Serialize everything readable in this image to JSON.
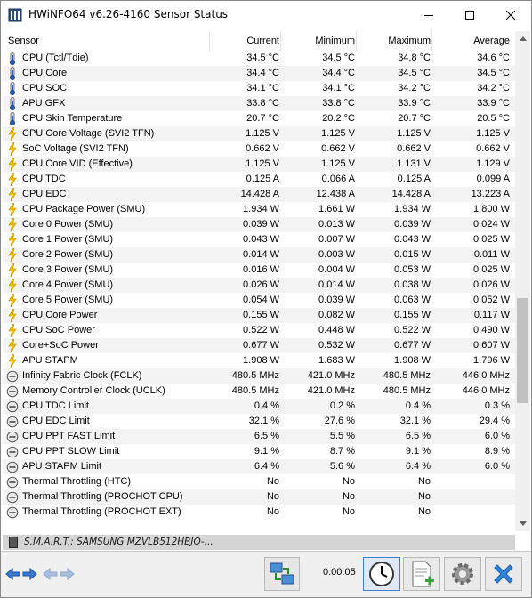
{
  "window": {
    "title": "HWiNFO64 v6.26-4160 Sensor Status"
  },
  "columns": {
    "sensor": "Sensor",
    "current": "Current",
    "minimum": "Minimum",
    "maximum": "Maximum",
    "average": "Average"
  },
  "rows": [
    {
      "icon": "thermometer",
      "name": "CPU (Tctl/Tdie)",
      "cur": "34.5 °C",
      "min": "34.5 °C",
      "max": "34.8 °C",
      "avg": "34.6 °C"
    },
    {
      "icon": "thermometer",
      "name": "CPU Core",
      "cur": "34.4 °C",
      "min": "34.4 °C",
      "max": "34.5 °C",
      "avg": "34.5 °C"
    },
    {
      "icon": "thermometer",
      "name": "CPU SOC",
      "cur": "34.1 °C",
      "min": "34.1 °C",
      "max": "34.2 °C",
      "avg": "34.2 °C"
    },
    {
      "icon": "thermometer",
      "name": "APU GFX",
      "cur": "33.8 °C",
      "min": "33.8 °C",
      "max": "33.9 °C",
      "avg": "33.9 °C"
    },
    {
      "icon": "thermometer",
      "name": "CPU Skin Temperature",
      "cur": "20.7 °C",
      "min": "20.2 °C",
      "max": "20.7 °C",
      "avg": "20.5 °C"
    },
    {
      "icon": "bolt",
      "name": "CPU Core Voltage (SVI2 TFN)",
      "cur": "1.125 V",
      "min": "1.125 V",
      "max": "1.125 V",
      "avg": "1.125 V"
    },
    {
      "icon": "bolt",
      "name": "SoC Voltage (SVI2 TFN)",
      "cur": "0.662 V",
      "min": "0.662 V",
      "max": "0.662 V",
      "avg": "0.662 V"
    },
    {
      "icon": "bolt",
      "name": "CPU Core VID (Effective)",
      "cur": "1.125 V",
      "min": "1.125 V",
      "max": "1.131 V",
      "avg": "1.129 V"
    },
    {
      "icon": "bolt",
      "name": "CPU TDC",
      "cur": "0.125 A",
      "min": "0.066 A",
      "max": "0.125 A",
      "avg": "0.099 A"
    },
    {
      "icon": "bolt",
      "name": "CPU EDC",
      "cur": "14.428 A",
      "min": "12.438 A",
      "max": "14.428 A",
      "avg": "13.223 A"
    },
    {
      "icon": "bolt",
      "name": "CPU Package Power (SMU)",
      "cur": "1.934 W",
      "min": "1.661 W",
      "max": "1.934 W",
      "avg": "1.800 W"
    },
    {
      "icon": "bolt",
      "name": "Core 0 Power (SMU)",
      "cur": "0.039 W",
      "min": "0.013 W",
      "max": "0.039 W",
      "avg": "0.024 W"
    },
    {
      "icon": "bolt",
      "name": "Core 1 Power (SMU)",
      "cur": "0.043 W",
      "min": "0.007 W",
      "max": "0.043 W",
      "avg": "0.025 W"
    },
    {
      "icon": "bolt",
      "name": "Core 2 Power (SMU)",
      "cur": "0.014 W",
      "min": "0.003 W",
      "max": "0.015 W",
      "avg": "0.011 W"
    },
    {
      "icon": "bolt",
      "name": "Core 3 Power (SMU)",
      "cur": "0.016 W",
      "min": "0.004 W",
      "max": "0.053 W",
      "avg": "0.025 W"
    },
    {
      "icon": "bolt",
      "name": "Core 4 Power (SMU)",
      "cur": "0.026 W",
      "min": "0.014 W",
      "max": "0.038 W",
      "avg": "0.026 W"
    },
    {
      "icon": "bolt",
      "name": "Core 5 Power (SMU)",
      "cur": "0.054 W",
      "min": "0.039 W",
      "max": "0.063 W",
      "avg": "0.052 W"
    },
    {
      "icon": "bolt",
      "name": "CPU Core Power",
      "cur": "0.155 W",
      "min": "0.082 W",
      "max": "0.155 W",
      "avg": "0.117 W"
    },
    {
      "icon": "bolt",
      "name": "CPU SoC Power",
      "cur": "0.522 W",
      "min": "0.448 W",
      "max": "0.522 W",
      "avg": "0.490 W"
    },
    {
      "icon": "bolt",
      "name": "Core+SoC Power",
      "cur": "0.677 W",
      "min": "0.532 W",
      "max": "0.677 W",
      "avg": "0.607 W"
    },
    {
      "icon": "bolt",
      "name": "APU STAPM",
      "cur": "1.908 W",
      "min": "1.683 W",
      "max": "1.908 W",
      "avg": "1.796 W"
    },
    {
      "icon": "gauge",
      "name": "Infinity Fabric Clock (FCLK)",
      "cur": "480.5 MHz",
      "min": "421.0 MHz",
      "max": "480.5 MHz",
      "avg": "446.0 MHz"
    },
    {
      "icon": "gauge",
      "name": "Memory Controller Clock (UCLK)",
      "cur": "480.5 MHz",
      "min": "421.0 MHz",
      "max": "480.5 MHz",
      "avg": "446.0 MHz"
    },
    {
      "icon": "gauge",
      "name": "CPU TDC Limit",
      "cur": "0.4 %",
      "min": "0.2 %",
      "max": "0.4 %",
      "avg": "0.3 %"
    },
    {
      "icon": "gauge",
      "name": "CPU EDC Limit",
      "cur": "32.1 %",
      "min": "27.6 %",
      "max": "32.1 %",
      "avg": "29.4 %"
    },
    {
      "icon": "gauge",
      "name": "CPU PPT FAST Limit",
      "cur": "6.5 %",
      "min": "5.5 %",
      "max": "6.5 %",
      "avg": "6.0 %"
    },
    {
      "icon": "gauge",
      "name": "CPU PPT SLOW Limit",
      "cur": "9.1 %",
      "min": "8.7 %",
      "max": "9.1 %",
      "avg": "8.9 %"
    },
    {
      "icon": "gauge",
      "name": "APU STAPM Limit",
      "cur": "6.4 %",
      "min": "5.6 %",
      "max": "6.4 %",
      "avg": "6.0 %"
    },
    {
      "icon": "gauge",
      "name": "Thermal Throttling (HTC)",
      "cur": "No",
      "min": "No",
      "max": "No",
      "avg": ""
    },
    {
      "icon": "gauge",
      "name": "Thermal Throttling (PROCHOT CPU)",
      "cur": "No",
      "min": "No",
      "max": "No",
      "avg": ""
    },
    {
      "icon": "gauge",
      "name": "Thermal Throttling (PROCHOT EXT)",
      "cur": "No",
      "min": "No",
      "max": "No",
      "avg": ""
    }
  ],
  "smart_group": "S.M.A.R.T.: SAMSUNG MZVLB512HBJQ-...",
  "toolbar": {
    "timer": "0:00:05"
  }
}
